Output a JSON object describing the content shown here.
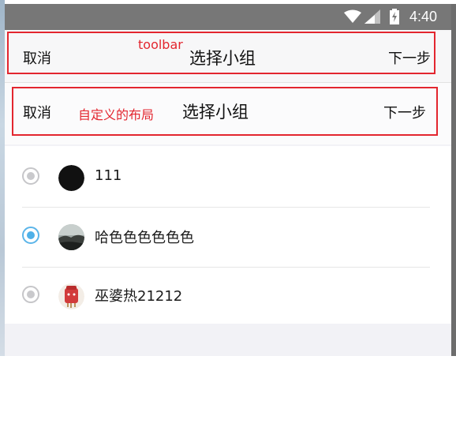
{
  "status_bar": {
    "time": "4:40",
    "icons": [
      "wifi-icon",
      "signal-icon",
      "battery-charging-icon"
    ]
  },
  "toolbar": {
    "cancel_label": "取消",
    "title": "选择小组",
    "next_label": "下一步"
  },
  "custom_bar": {
    "cancel_label": "取消",
    "title": "选择小组",
    "next_label": "下一步"
  },
  "annotations": {
    "toolbar_note": "toolbar",
    "custom_note": "自定义的布局",
    "color": "#e3262f"
  },
  "groups": [
    {
      "name": "111",
      "selected": false,
      "avatar": "black-circle-avatar"
    },
    {
      "name": "哈色色色色色色",
      "selected": true,
      "avatar": "landscape-avatar"
    },
    {
      "name": "巫婆热21212",
      "selected": false,
      "avatar": "red-character-avatar"
    }
  ],
  "colors": {
    "status_bar": "#777777",
    "radio_selected": "#4fb0e8",
    "radio_unselected": "#c9c9cc"
  }
}
